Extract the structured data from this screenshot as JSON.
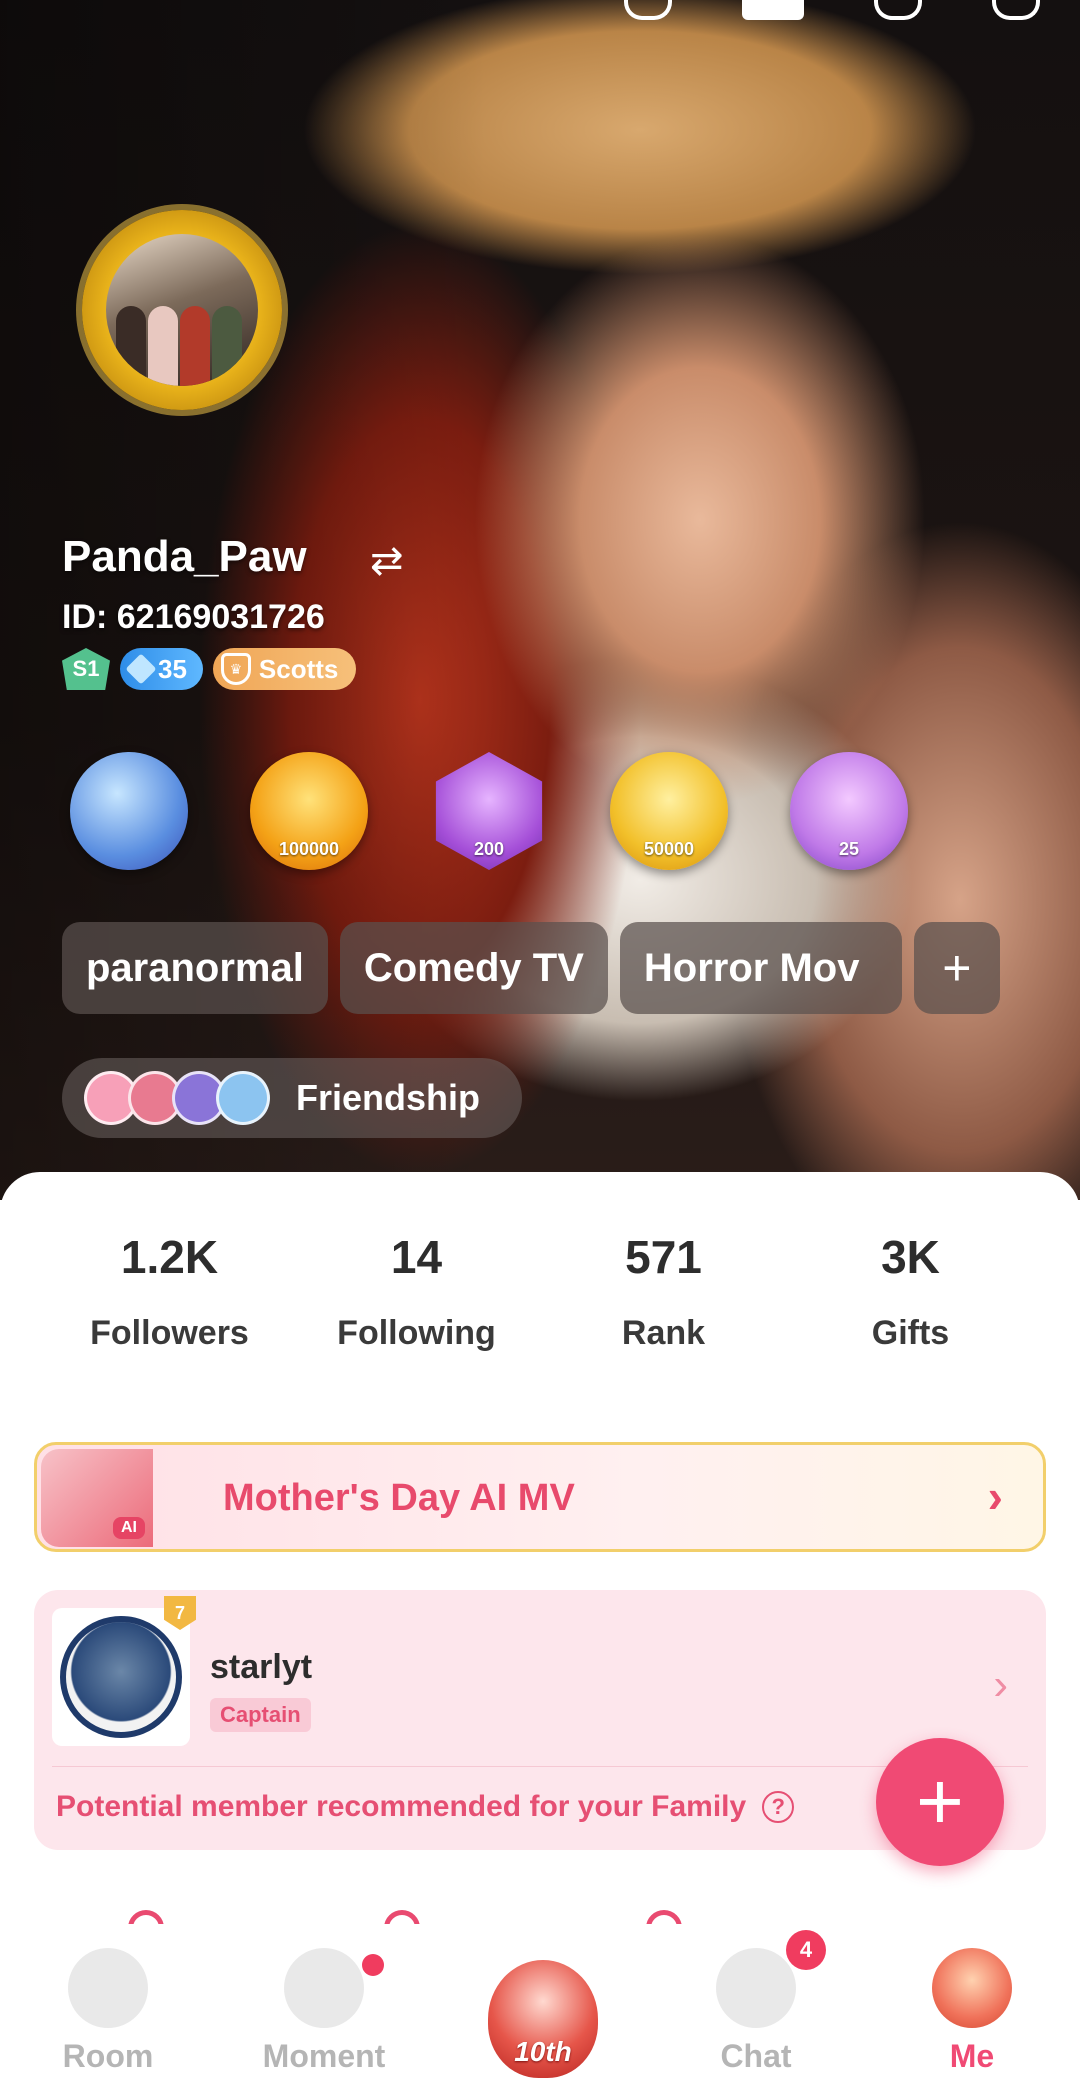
{
  "profile": {
    "username": "Panda_Paw",
    "id_text": "ID: 62169031726",
    "level_badge": "S1",
    "diamond_level": "35",
    "family_badge": "Scotts"
  },
  "medals": [
    "",
    "100000",
    "200",
    "50000",
    "25"
  ],
  "tags": [
    {
      "label": "paranormal"
    },
    {
      "label": "Comedy TV"
    },
    {
      "label": "Horror Mov"
    }
  ],
  "tag_add": "+",
  "friendship_label": "Friendship",
  "stats": [
    {
      "value": "1.2K",
      "label": "Followers"
    },
    {
      "value": "14",
      "label": "Following"
    },
    {
      "value": "571",
      "label": "Rank"
    },
    {
      "value": "3K",
      "label": "Gifts"
    }
  ],
  "banner": {
    "title": "Mother's Day AI MV",
    "art_tag": "AI",
    "chevron": "›"
  },
  "family": {
    "rank": "7",
    "name": "starlyt",
    "role": "Captain",
    "recommendation": "Potential member recommended for your Family",
    "help": "?",
    "chevron": "›"
  },
  "fab": "+",
  "nav": {
    "items": [
      {
        "label": "Room"
      },
      {
        "label": "Moment"
      },
      {
        "label": ""
      },
      {
        "label": "Chat"
      },
      {
        "label": "Me"
      }
    ],
    "chat_badge": "4",
    "center_logo": "10th",
    "active": "Me"
  },
  "colors": {
    "accent": "#f04a74",
    "banner_border": "#f2cf6b",
    "family_bg": "#fde6ec"
  }
}
